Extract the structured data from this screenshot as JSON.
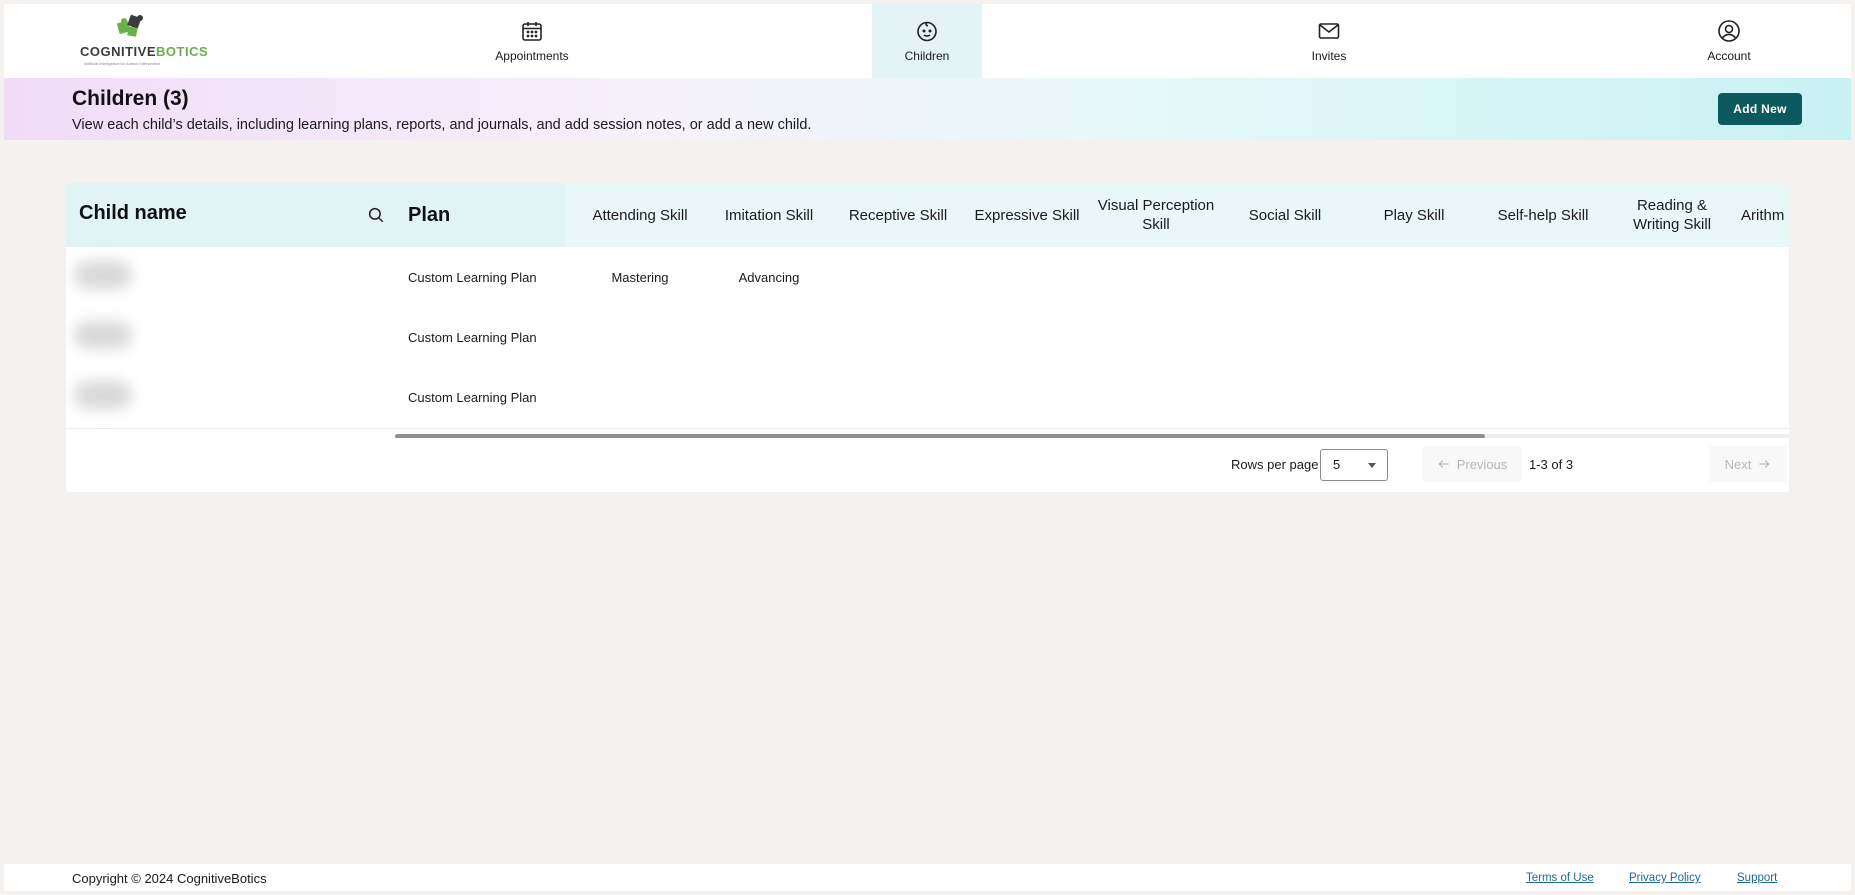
{
  "brand": {
    "name_dark": "COGNITIVE",
    "name_green": "BOTICS",
    "tagline": "Artificial Intelligence for Autism Intervention",
    "colors": {
      "primary": "#0c5a5d",
      "green": "#6ab04c",
      "active_tab": "#e4f4f6"
    }
  },
  "nav": {
    "items": [
      {
        "label": "Appointments",
        "icon": "calendar-icon"
      },
      {
        "label": "Children",
        "icon": "child-face-icon",
        "active": true
      },
      {
        "label": "Invites",
        "icon": "envelope-icon"
      },
      {
        "label": "Account",
        "icon": "user-circle-icon"
      }
    ]
  },
  "header": {
    "title": "Children (3)",
    "description": "View each child’s details, including learning plans, reports, and journals, and add session notes, or add a new child.",
    "add_button": "Add New"
  },
  "table": {
    "name_header": "Child name",
    "columns": [
      "Plan",
      "Attending Skill",
      "Imitation Skill",
      "Receptive Skill",
      "Expressive Skill",
      "Visual Perception Skill",
      "Social Skill",
      "Play Skill",
      "Self-help Skill",
      "Reading & Writing Skill",
      "Arithm"
    ],
    "rows": [
      {
        "plan": "Custom Learning Plan",
        "attending": "Mastering",
        "imitation": "Advancing"
      },
      {
        "plan": "Custom Learning Plan",
        "attending": "",
        "imitation": ""
      },
      {
        "plan": "Custom Learning Plan",
        "attending": "",
        "imitation": ""
      }
    ]
  },
  "pagination": {
    "rows_per_page_label": "Rows per page",
    "rows_per_page_value": "5",
    "previous": "Previous",
    "range": "1-3 of 3",
    "next": "Next"
  },
  "footer": {
    "copyright": "Copyright © 2024 CognitiveBotics",
    "links": [
      "Terms of Use",
      "Privacy Policy",
      "Support"
    ]
  }
}
